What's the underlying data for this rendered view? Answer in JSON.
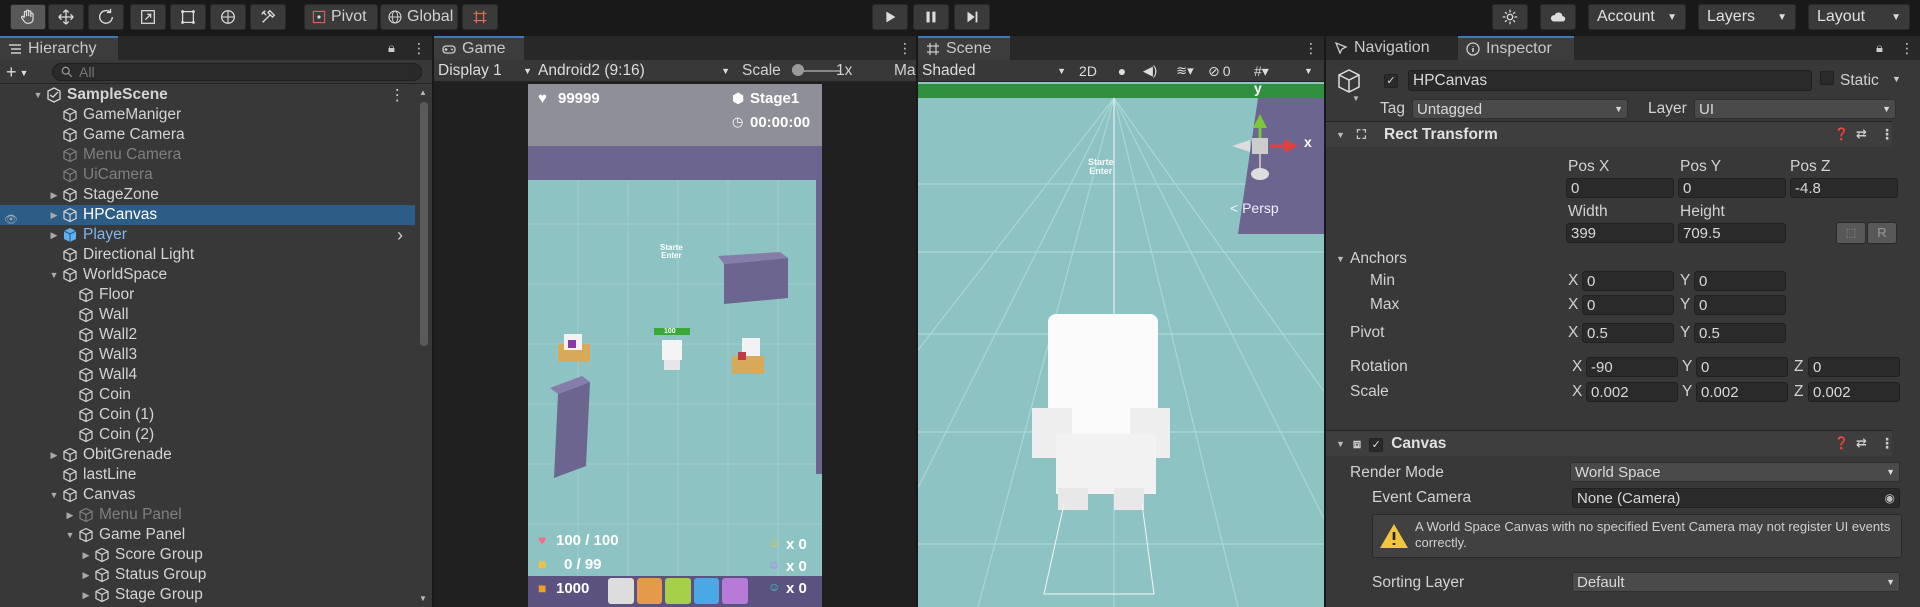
{
  "toolbar": {
    "pivot": "Pivot",
    "global": "Global",
    "account": "Account",
    "layers": "Layers",
    "layout": "Layout"
  },
  "hierarchy": {
    "tab": "Hierarchy",
    "search_placeholder": "All",
    "add": "+",
    "rows": [
      {
        "label": "SampleScene",
        "indent": 0,
        "fold": "▼",
        "kind": "scene",
        "state": "normal"
      },
      {
        "label": "GameManiger",
        "indent": 1,
        "fold": "",
        "kind": "cube",
        "state": "normal"
      },
      {
        "label": "Game Camera",
        "indent": 1,
        "fold": "",
        "kind": "cube",
        "state": "normal"
      },
      {
        "label": "Menu Camera",
        "indent": 1,
        "fold": "",
        "kind": "cube",
        "state": "dim"
      },
      {
        "label": "UiCamera",
        "indent": 1,
        "fold": "",
        "kind": "cube",
        "state": "dim"
      },
      {
        "label": "StageZone",
        "indent": 1,
        "fold": "▶",
        "kind": "cube",
        "state": "normal"
      },
      {
        "label": "HPCanvas",
        "indent": 1,
        "fold": "▶",
        "kind": "cube",
        "state": "sel"
      },
      {
        "label": "Player",
        "indent": 1,
        "fold": "▶",
        "kind": "prefab",
        "state": "prefab"
      },
      {
        "label": "Directional Light",
        "indent": 1,
        "fold": "",
        "kind": "cube",
        "state": "normal"
      },
      {
        "label": "WorldSpace",
        "indent": 1,
        "fold": "▼",
        "kind": "cube",
        "state": "normal"
      },
      {
        "label": "Floor",
        "indent": 2,
        "fold": "",
        "kind": "cube",
        "state": "normal"
      },
      {
        "label": "Wall",
        "indent": 2,
        "fold": "",
        "kind": "cube",
        "state": "normal"
      },
      {
        "label": "Wall2",
        "indent": 2,
        "fold": "",
        "kind": "cube",
        "state": "normal"
      },
      {
        "label": "Wall3",
        "indent": 2,
        "fold": "",
        "kind": "cube",
        "state": "normal"
      },
      {
        "label": "Wall4",
        "indent": 2,
        "fold": "",
        "kind": "cube",
        "state": "normal"
      },
      {
        "label": "Coin",
        "indent": 2,
        "fold": "",
        "kind": "cube",
        "state": "normal"
      },
      {
        "label": "Coin (1)",
        "indent": 2,
        "fold": "",
        "kind": "cube",
        "state": "normal"
      },
      {
        "label": "Coin (2)",
        "indent": 2,
        "fold": "",
        "kind": "cube",
        "state": "normal"
      },
      {
        "label": "ObitGrenade",
        "indent": 1,
        "fold": "▶",
        "kind": "cube",
        "state": "normal"
      },
      {
        "label": "lastLine",
        "indent": 1,
        "fold": "",
        "kind": "cube",
        "state": "normal"
      },
      {
        "label": "Canvas",
        "indent": 1,
        "fold": "▼",
        "kind": "cube",
        "state": "normal"
      },
      {
        "label": "Menu Panel",
        "indent": 2,
        "fold": "▶",
        "kind": "cube",
        "state": "dim"
      },
      {
        "label": "Game Panel",
        "indent": 2,
        "fold": "▼",
        "kind": "cube",
        "state": "normal"
      },
      {
        "label": "Score Group",
        "indent": 3,
        "fold": "▶",
        "kind": "cube",
        "state": "normal"
      },
      {
        "label": "Status Group",
        "indent": 3,
        "fold": "▶",
        "kind": "cube",
        "state": "normal"
      },
      {
        "label": "Stage Group",
        "indent": 3,
        "fold": "▶",
        "kind": "cube",
        "state": "normal"
      }
    ]
  },
  "game": {
    "tab": "Game",
    "display": "Display 1",
    "resolution": "Android2 (9:16)",
    "scale_label": "Scale",
    "scale_value": "1x",
    "maximize": "Ma",
    "hud": {
      "score": "99999",
      "stage": "Stage1",
      "time": "00:00:00",
      "hp": "100 / 100",
      "ammo": "0 / 99",
      "coin": "1000",
      "count1": "x 0",
      "count2": "x 0",
      "count3": "x 0",
      "start_text": "Starte\nEnter",
      "player_hp": "100"
    }
  },
  "scene": {
    "tab": "Scene",
    "shading": "Shaded",
    "mode_2d": "2D",
    "hidden_count": "0",
    "gizmo_y": "y",
    "gizmo_x": "x",
    "persp": "< Persp",
    "start_text": "Starte\nEnter"
  },
  "navigation": {
    "tab": "Navigation"
  },
  "inspector": {
    "tab": "Inspector",
    "object_name": "HPCanvas",
    "static_label": "Static",
    "tag_label": "Tag",
    "tag_value": "Untagged",
    "layer_label": "Layer",
    "layer_value": "UI",
    "rect_transform": {
      "title": "Rect Transform",
      "pos_x_label": "Pos X",
      "pos_y_label": "Pos Y",
      "pos_z_label": "Pos Z",
      "pos_x": "0",
      "pos_y": "0",
      "pos_z": "-4.8",
      "width_label": "Width",
      "height_label": "Height",
      "width": "399",
      "height": "709.5",
      "r_button": "R",
      "anchors_label": "Anchors",
      "min_label": "Min",
      "max_label": "Max",
      "min_x": "0",
      "min_y": "0",
      "max_x": "0",
      "max_y": "0",
      "pivot_label": "Pivot",
      "pivot_x": "0.5",
      "pivot_y": "0.5",
      "rotation_label": "Rotation",
      "rot_x": "-90",
      "rot_y": "0",
      "rot_z": "0",
      "scale_label": "Scale",
      "scale_x": "0.002",
      "scale_y": "0.002",
      "scale_z": "0.002",
      "x": "X",
      "y": "Y",
      "z": "Z"
    },
    "canvas": {
      "title": "Canvas",
      "render_mode_label": "Render Mode",
      "render_mode": "World Space",
      "event_camera_label": "Event Camera",
      "event_camera": "None (Camera)",
      "warning": "A World Space Canvas with no specified Event Camera may not register UI events correctly.",
      "sorting_layer_label": "Sorting Layer",
      "sorting_layer": "Default"
    }
  },
  "colors": {
    "selection": "#2c5d87",
    "accent": "#3a79bb",
    "floor": "#8ec3c3",
    "wall": "#6b6590"
  }
}
